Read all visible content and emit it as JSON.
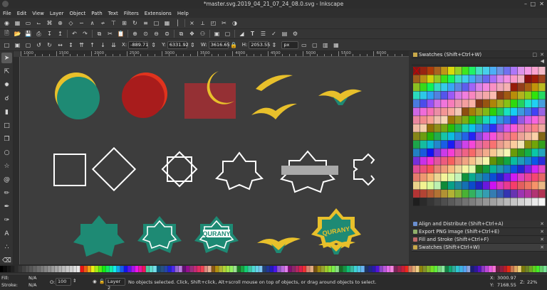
{
  "window": {
    "title": "*master.svg.2019_04_21_07_24_08.0.svg - Inkscape",
    "app_icon": "inkscape-icon"
  },
  "menu": [
    "File",
    "Edit",
    "View",
    "Layer",
    "Object",
    "Path",
    "Text",
    "Filters",
    "Extensions",
    "Help"
  ],
  "controls": {
    "x_label": "X:",
    "x_value": "-889.71",
    "y_label": "Y:",
    "y_value": "6331.92",
    "w_label": "W:",
    "w_value": "3616.65",
    "h_label": "H:",
    "h_value": "2053.55",
    "unit": "px"
  },
  "ruler": {
    "top_labels": [
      "1000",
      "1500",
      "2000",
      "2500",
      "3000",
      "3500",
      "4000",
      "4500",
      "5000",
      "5500",
      "6000"
    ]
  },
  "tools": [
    "selector-icon",
    "node-icon",
    "tweak-icon",
    "zoom-icon",
    "measure-icon",
    "rect-icon",
    "box3d-icon",
    "ellipse-icon",
    "star-icon",
    "spiral-icon",
    "pencil-icon",
    "pen-icon",
    "calligraphy-icon",
    "text-icon",
    "spray-icon",
    "eraser-icon"
  ],
  "dock": {
    "swatches_title": "Swatches (Shift+Ctrl+W)",
    "tabs": [
      {
        "label": "Align and Distribute (Shift+Ctrl+A)",
        "color": "#6a8fd0"
      },
      {
        "label": "Export PNG Image (Shift+Ctrl+E)",
        "color": "#8fb06a"
      },
      {
        "label": "Fill and Stroke (Shift+Ctrl+F)",
        "color": "#c06a6a"
      },
      {
        "label": "Swatches (Shift+Ctrl+W)",
        "color": "#c9a94a"
      }
    ]
  },
  "artwork": {
    "badge_text": "QURANY"
  },
  "colors": {
    "teal": "#1e8a74",
    "gold": "#e8c02b",
    "red": "#b01f1f",
    "outline": "#ffffff",
    "gray_bar": "#a9a9a9"
  },
  "status": {
    "fill_label": "Fill:",
    "fill_value": "N/A",
    "stroke_label": "Stroke:",
    "stroke_value": "N/A",
    "opacity_label": "O:",
    "opacity_value": "100",
    "layer": "Layer 2",
    "message": "No objects selected. Click, Shift+click, Alt+scroll mouse on top of objects, or drag around objects to select.",
    "cursor_x_label": "X:",
    "cursor_x": "3000.97",
    "cursor_y_label": "Y:",
    "cursor_y": "7168.55",
    "zoom_label": "Z:",
    "zoom": "22%"
  }
}
